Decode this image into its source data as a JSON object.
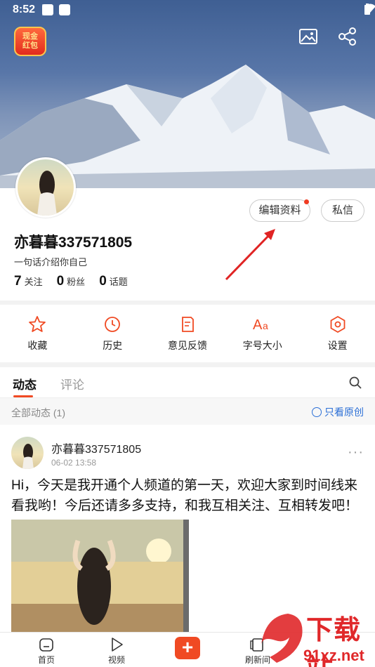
{
  "status_bar": {
    "time": "8:52"
  },
  "header": {
    "cash_badge": "现金\n红包"
  },
  "profile": {
    "edit_button": "编辑资料",
    "message_button": "私信",
    "username": "亦暮暮337571805",
    "bio": "一句话介绍你自己",
    "stats": [
      {
        "value": "7",
        "label": "关注"
      },
      {
        "value": "0",
        "label": "粉丝"
      },
      {
        "value": "0",
        "label": "话题"
      }
    ]
  },
  "menu": [
    {
      "label": "收藏",
      "icon": "star-icon"
    },
    {
      "label": "历史",
      "icon": "clock-icon"
    },
    {
      "label": "意见反馈",
      "icon": "feedback-icon"
    },
    {
      "label": "字号大小",
      "icon": "font-size-icon"
    },
    {
      "label": "设置",
      "icon": "settings-icon"
    }
  ],
  "tabs": {
    "active": "动态",
    "inactive": "评论"
  },
  "filter": {
    "all": "全部动态 (1)",
    "original_only": "只看原创"
  },
  "post": {
    "author": "亦暮暮337571805",
    "time": "06-02 13:58",
    "more": "···",
    "text": "Hi，今天是我开通个人频道的第一天，欢迎大家到时间线来看我哟！今后还请多多支持，和我互相关注、互相转发吧！"
  },
  "bottom_nav": [
    {
      "label": "首页",
      "icon": "home-icon"
    },
    {
      "label": "视频",
      "icon": "play-icon"
    },
    {
      "label": "刷新间",
      "icon": "refresh-icon"
    }
  ],
  "watermark": {
    "text": "下载站",
    "url": "91xz.net"
  },
  "colors": {
    "accent": "#f04a23",
    "link": "#2b6fd6"
  }
}
